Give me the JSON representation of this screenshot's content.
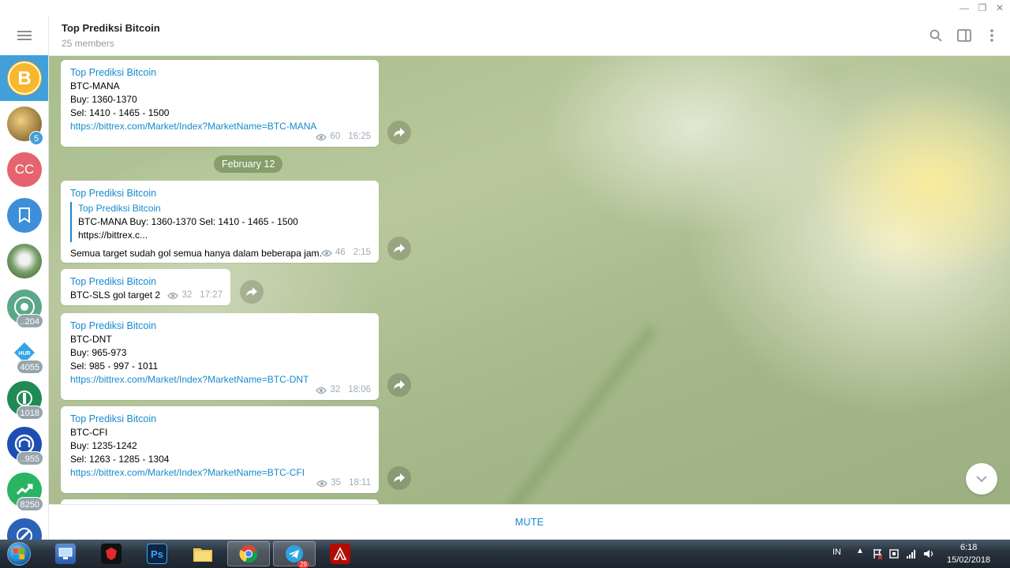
{
  "window": {
    "minimize": "—",
    "restore": "❐",
    "close": "✕"
  },
  "header": {
    "title": "Top Prediksi Bitcoin",
    "subtitle": "25 members"
  },
  "sidebar": {
    "chats": [
      {
        "icon": "bitcoin-icon",
        "initials": "",
        "badge": "",
        "color": "#e8a21a",
        "active": true
      },
      {
        "icon": "gold-coin-icon",
        "initials": "",
        "badge": "5",
        "color": "#7a5a20",
        "active": false
      },
      {
        "initials": "CC",
        "badge": "",
        "color": "#e5646f",
        "active": false
      },
      {
        "icon": "bookmark-icon",
        "initials": "",
        "badge": "",
        "color": "#3d8fd9",
        "active": false
      },
      {
        "icon": "photo-avatar-icon",
        "initials": "",
        "badge": "",
        "color": "#4e7a46",
        "active": false
      },
      {
        "icon": "coin-logo-icon",
        "initials": "",
        "badge": "..204",
        "color": "#5aa889",
        "active": false
      },
      {
        "icon": "hur-icon",
        "initials": "HUR",
        "badge": "4055",
        "color": "#2fa6e6",
        "active": false
      },
      {
        "icon": "coin-logo-icon",
        "initials": "",
        "badge": "1018",
        "color": "#1f8a55",
        "active": false
      },
      {
        "icon": "coin-logo-icon",
        "initials": "",
        "badge": "..955",
        "color": "#1d4fb3",
        "active": false
      },
      {
        "icon": "chart-up-icon",
        "initials": "",
        "badge": "8250",
        "color": "#28b463",
        "active": false
      },
      {
        "icon": "coin-logo-icon",
        "initials": "",
        "badge": "",
        "color": "#2a62b8",
        "active": false
      }
    ]
  },
  "messages": [
    {
      "name": "Top Prediksi Bitcoin",
      "lines": [
        "BTC-MANA",
        "Buy: 1360-1370",
        "Sel: 1410 - 1465 - 1500"
      ],
      "link": "https://bittrex.com/Market/Index?MarketName=BTC-MANA",
      "views": "60",
      "time": "16:25"
    },
    {
      "name": "Top Prediksi Bitcoin",
      "quote_name": "Top Prediksi Bitcoin",
      "quote_text": "BTC-MANA Buy: 1360-1370 Sel: 1410 - 1465 - 1500 https://bittrex.c...",
      "text": "Semua target sudah gol semua hanya dalam beberapa jam.",
      "views": "46",
      "time": "2:15"
    },
    {
      "name": "Top Prediksi Bitcoin",
      "text": "BTC-SLS gol target 2",
      "views": "32",
      "time": "17:27"
    },
    {
      "name": "Top Prediksi Bitcoin",
      "lines": [
        "BTC-DNT",
        "Buy: 965-973",
        "Sel: 985 - 997 - 1011"
      ],
      "link": "https://bittrex.com/Market/Index?MarketName=BTC-DNT",
      "views": "32",
      "time": "18:06"
    },
    {
      "name": "Top Prediksi Bitcoin",
      "lines": [
        "BTC-CFI",
        "Buy: 1235-1242",
        "Sel: 1263 - 1285 - 1304"
      ],
      "link": "https://bittrex.com/Market/Index?MarketName=BTC-CFI",
      "views": "35",
      "time": "18:11"
    }
  ],
  "date_separator": "February 12",
  "bottom": {
    "mute_label": "MUTE"
  },
  "taskbar": {
    "apps": [
      "computer-icon",
      "garena-icon",
      "photoshop-icon",
      "folder-icon",
      "chrome-icon",
      "telegram-icon",
      "adobe-reader-icon"
    ],
    "photoshop_label": "Ps",
    "telegram_badge": "29",
    "lang": "IN",
    "time": "6:18",
    "date": "15/02/2018"
  }
}
